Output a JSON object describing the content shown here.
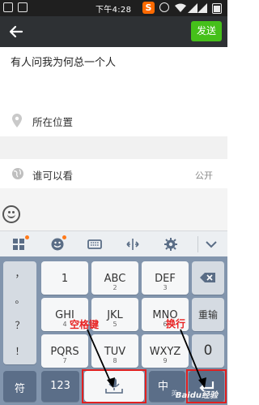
{
  "status_bar": {
    "time": "下午4:28",
    "sogou_icon_letter": "S",
    "icons": [
      "image-notification-icon",
      "photo-notification-icon",
      "sogou-input-icon",
      "alarm-icon",
      "wifi-icon",
      "signal-icon",
      "battery-icon"
    ]
  },
  "title_bar": {
    "back_icon": "back-arrow-icon",
    "send_label": "发送",
    "send_color": "#45c01a"
  },
  "post": {
    "text": "有人问我为何总一个人"
  },
  "location": {
    "label": "所在位置",
    "icon": "location-pin-icon"
  },
  "visibility": {
    "label": "谁可以看",
    "value": "公开",
    "icon": "globe-icon"
  },
  "emoji_button_icon": "smiley-icon",
  "keyboard_toolbar": {
    "icons": [
      "app-grid-icon",
      "emoji-icon",
      "keyboard-icon",
      "cursor-move-icon",
      "settings-icon",
      "collapse-chevron-icon"
    ]
  },
  "keyboard": {
    "side_symbols": [
      "，",
      "。",
      "？",
      "！"
    ],
    "rows": [
      [
        {
          "main": "1",
          "sub": ""
        },
        {
          "main": "ABC",
          "sub": "2"
        },
        {
          "main": "DEF",
          "sub": "3"
        }
      ],
      [
        {
          "main": "GHI",
          "sub": "4"
        },
        {
          "main": "JKL",
          "sub": "5"
        },
        {
          "main": "MNO",
          "sub": "6"
        }
      ],
      [
        {
          "main": "PQRS",
          "sub": "7"
        },
        {
          "main": "TUV",
          "sub": "8"
        },
        {
          "main": "WXYZ",
          "sub": "9"
        }
      ]
    ],
    "backspace_icon": "backspace-icon",
    "retype_label": "重输",
    "zero_label": "0",
    "bottom": {
      "symbol_label": "符",
      "number_label": "123",
      "space_icon": "microphone-space-icon",
      "lang_label": "中",
      "lang_sub": "英",
      "enter_icon": "enter-icon"
    }
  },
  "annotations": {
    "space_label": "空格键",
    "newline_label": "换行",
    "color": "#e82121"
  },
  "watermark": "Baidu经验"
}
